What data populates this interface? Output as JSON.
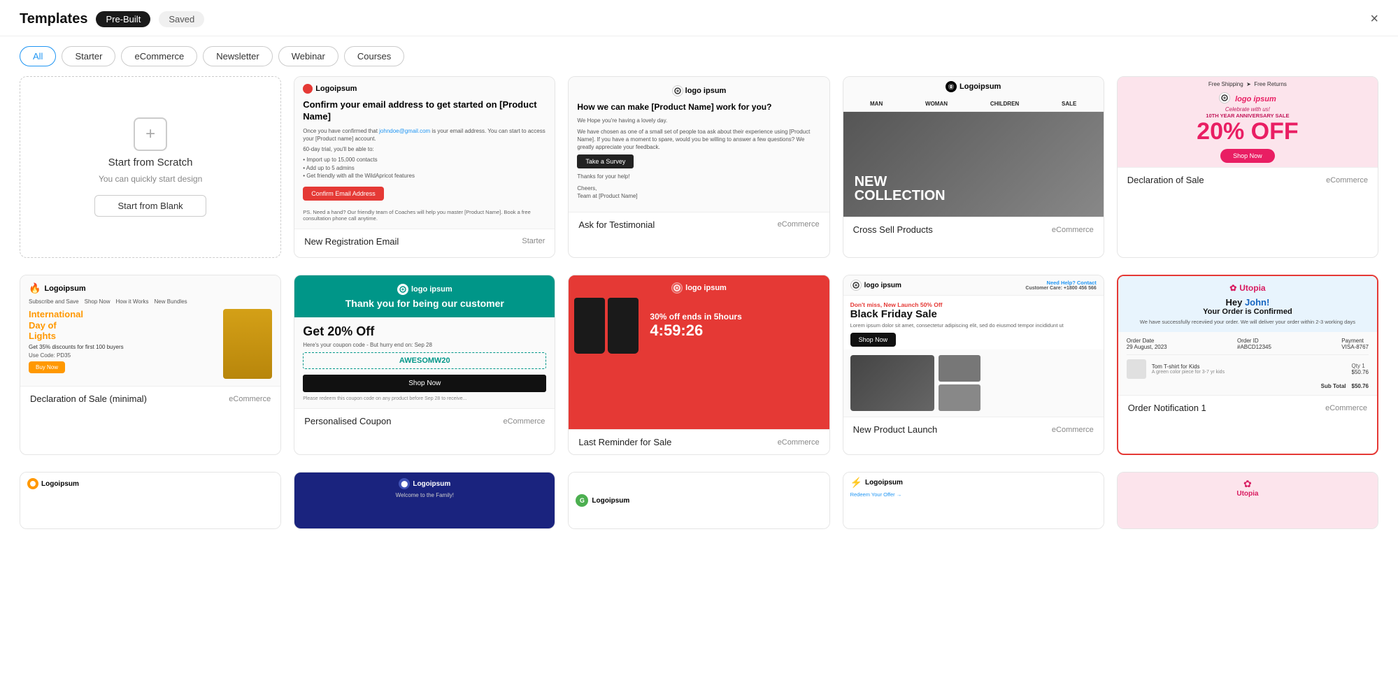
{
  "header": {
    "title": "Templates",
    "tab_prebuilt": "Pre-Built",
    "tab_saved": "Saved",
    "close_label": "×"
  },
  "filters": {
    "items": [
      {
        "id": "all",
        "label": "All",
        "active": true
      },
      {
        "id": "starter",
        "label": "Starter",
        "active": false
      },
      {
        "id": "ecommerce",
        "label": "eCommerce",
        "active": false
      },
      {
        "id": "newsletter",
        "label": "Newsletter",
        "active": false
      },
      {
        "id": "webinar",
        "label": "Webinar",
        "active": false
      },
      {
        "id": "courses",
        "label": "Courses",
        "active": false
      }
    ]
  },
  "scratch_card": {
    "title": "Start from Scratch",
    "subtitle": "You can quickly start design",
    "button": "Start from Blank"
  },
  "templates": [
    {
      "id": "new-registration",
      "name": "New Registration Email",
      "tag": "Starter",
      "highlighted": false,
      "preview_type": "registration"
    },
    {
      "id": "ask-testimonial",
      "name": "Ask for Testimonial",
      "tag": "eCommerce",
      "highlighted": false,
      "preview_type": "testimonial"
    },
    {
      "id": "cross-sell",
      "name": "Cross Sell Products",
      "tag": "eCommerce",
      "highlighted": false,
      "preview_type": "crosssell"
    },
    {
      "id": "declaration-sale",
      "name": "Declaration of Sale",
      "tag": "eCommerce",
      "highlighted": false,
      "preview_type": "declaration"
    },
    {
      "id": "declaration-minimal",
      "name": "Declaration of Sale (minimal)",
      "tag": "eCommerce",
      "highlighted": false,
      "preview_type": "declminimal"
    },
    {
      "id": "personalised-coupon",
      "name": "Personalised Coupon",
      "tag": "eCommerce",
      "highlighted": false,
      "preview_type": "coupon"
    },
    {
      "id": "last-reminder",
      "name": "Last Reminder for Sale",
      "tag": "eCommerce",
      "highlighted": false,
      "preview_type": "reminder"
    },
    {
      "id": "new-product-launch",
      "name": "New Product Launch",
      "tag": "eCommerce",
      "highlighted": false,
      "preview_type": "newproduct"
    },
    {
      "id": "order-notification-1",
      "name": "Order Notification 1",
      "tag": "eCommerce",
      "highlighted": true,
      "preview_type": "ordernotification"
    }
  ],
  "bottom_partial": [
    {
      "id": "bottom-1",
      "preview_type": "bottom1"
    },
    {
      "id": "bottom-2",
      "preview_type": "bottom2"
    },
    {
      "id": "bottom-3",
      "preview_type": "bottom3"
    },
    {
      "id": "bottom-4",
      "preview_type": "bottom4"
    },
    {
      "id": "bottom-5",
      "preview_type": "bottom5"
    }
  ],
  "mock_content": {
    "registration": {
      "logo": "Logoipsum",
      "heading": "Confirm your email address to get started on [Product Name]",
      "body1": "Once you have confirmed that johndoe@gmail.com is your email address. You can start to access your [Product name] account.",
      "body2": "60-day trial, you'll be able to:",
      "bullets": [
        "Import up to 15,000 contacts",
        "Add up to 5 admins",
        "Get friendly with all the WildApricot features"
      ],
      "button": "Confirm Email Address",
      "ps": "PS: Need a hand? Our friendly team of Coaches will help you master [Product Name]. Book a free consultation phone call anytime."
    },
    "testimonial": {
      "logo": "logo ipsum",
      "heading": "How we can make [Product Name] work for you?",
      "intro": "We Hope you're having a lovely day.",
      "body": "We have chosen as one of a small set of people to ask about their experience using [Product Name]. If you have a moment to spare, would you be willing to answer a few questions? We greatly appreciate your feedback.",
      "button": "Take a Survey",
      "thanks": "Thanks for your help!",
      "sign": "Cheers, Team at [Product Name]"
    },
    "crosssell": {
      "logo": "Logoipsum",
      "nav": [
        "MAN",
        "WOMAN",
        "CHILDREN",
        "SALE"
      ],
      "overlay1": "NEW",
      "overlay2": "COLLECTION"
    },
    "declaration": {
      "shipping": "Free Shipping  >  Free Returns",
      "logo": "logo ipsum",
      "celebrate": "Celebrate with us!",
      "anniversary": "10TH YEAR ANNIVERSARY SALE",
      "discount": "20% OFF",
      "button": "Shop Now"
    },
    "declminimal": {
      "logo": "Logoipsum",
      "nav": [
        "Subscribe and Save",
        "Shop Now",
        "How it Works",
        "New Bundles"
      ],
      "heading1": "International",
      "heading2": "Day of",
      "heading3": "Lights",
      "promo": "Get 35% discounts for first 100 buyers",
      "code": "Use Code: PD35",
      "button": "Buy Now"
    },
    "coupon": {
      "logo": "logo ipsum",
      "banner": "Thank you for being our customer",
      "heading": "Get 20% Off",
      "sub": "Here's your coupon code - But hurry end on: Sep 28",
      "code": "AWESOMW20",
      "button": "Shop Now",
      "note": "Please redeem this coupon code on any product before Sep 28 to receive..."
    },
    "reminder": {
      "logo": "logo ipsum",
      "pct": "30% off ends in 5hours",
      "timer": "4:59:26"
    },
    "newproduct": {
      "logo": "logo ipsum",
      "need_help": "Need Help? Contact",
      "customer_care": "Customer Care: +1800 456 566",
      "dont": "Don't miss, New Launch 50% Off",
      "heading": "Black Friday Sale",
      "body": "Lorem ipsum dolor sit amet, consectetur adipiscing elit, sed do eiusmod tempor incididunt ut",
      "button": "Shop Now"
    },
    "ordernotification": {
      "logo": "Utopia",
      "greeting": "Hey John!",
      "greeting_hi": "John!",
      "confirmed": "Your Order is Confirmed",
      "sub": "We have successfully receviied your order. We will deliver your order within 2-3 working days",
      "order_date_label": "Order Date",
      "order_date": "29 August, 2023",
      "order_id_label": "Order ID",
      "order_id": "#ABCD12345",
      "payment_label": "Payment",
      "payment": "VISA-8767",
      "item_name": "Tom T-shirt for Kids",
      "item_sub": "A green color piece for 3-7 yr kids",
      "qty": "Qty 1",
      "price": "$50.76",
      "sub_total_label": "Sub Total",
      "sub_total": "$50.76"
    }
  }
}
